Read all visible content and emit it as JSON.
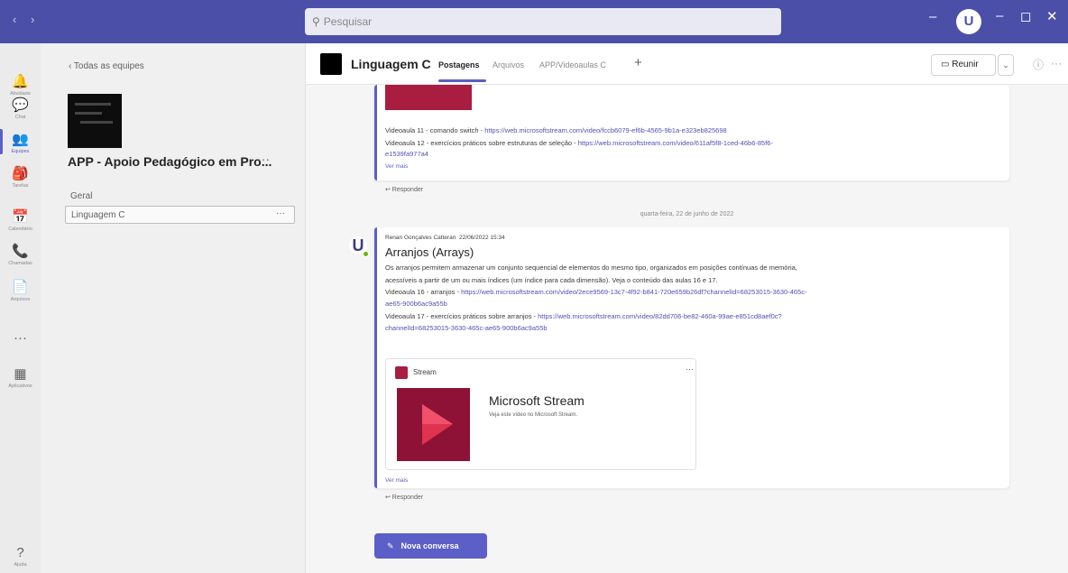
{
  "titlebar": {
    "nav": "‹ ›",
    "search_placeholder": "Pesquisar",
    "search_icon": "search-icon",
    "more": "···",
    "avatar_initial": "U",
    "minimize": "–",
    "maximize": "◻",
    "close": "✕",
    "bg_color": "#4b4fa8"
  },
  "rail": {
    "items": [
      {
        "label": "Atividade",
        "icon": "bell-icon",
        "glyph": "🔔"
      },
      {
        "label": "Chat",
        "icon": "chat-icon",
        "glyph": "💬"
      },
      {
        "label": "Equipes",
        "icon": "teams-icon",
        "glyph": "👥"
      },
      {
        "label": "Tarefas",
        "icon": "assignments-icon",
        "glyph": "🎒"
      },
      {
        "label": "Calendário",
        "icon": "calendar-icon",
        "glyph": "📅"
      },
      {
        "label": "Chamadas",
        "icon": "phone-icon",
        "glyph": "📞"
      },
      {
        "label": "Arquivos",
        "icon": "file-icon",
        "glyph": "📄"
      },
      {
        "label": "",
        "icon": "more-icon",
        "glyph": "···"
      },
      {
        "label": "Aplicativos",
        "icon": "apps-icon",
        "glyph": "▦"
      },
      {
        "label": "Ajuda",
        "icon": "help-icon",
        "glyph": "?"
      }
    ],
    "active_index": 2
  },
  "team_panel": {
    "back_label": "‹  Todas as equipes",
    "team_name": "APP - Apoio Pedagógico em Pro...",
    "team_more": "···",
    "channels": [
      {
        "label": "Geral",
        "selected": false
      },
      {
        "label": "Linguagem C",
        "selected": true
      }
    ],
    "channel_more": "···"
  },
  "channel_header": {
    "name": "Linguagem C",
    "tabs": [
      {
        "label": "Postagens",
        "active": true
      },
      {
        "label": "Arquivos",
        "active": false
      },
      {
        "label": "APP/Videoaulas C",
        "active": false
      }
    ],
    "add_tab": "+",
    "meet_label": "Reunir",
    "meet_icon": "video-icon",
    "meet_drop": "⌄",
    "info_icon": "info-icon",
    "more": "···"
  },
  "post1": {
    "line1_text": "Videoaula 11 - comando switch - ",
    "line1_link": "https://web.microsoftstream.com/video/fccb6079-ef6b-4565-9b1a-e323eb825698",
    "line2_text": "Videoaula 12 - exercícios práticos sobre estruturas de seleção - ",
    "line2_link": "https://web.microsoftstream.com/video/611af5f8-1ced-46b6-85f6-",
    "line3_link": "e1539fa977a4",
    "see_more": "Ver mais",
    "reply": "↩ Responder"
  },
  "date_separator": "quarta-feira, 22 de junho de 2022",
  "post2": {
    "author": "Renan Gonçalves Catteran",
    "time": "22/06/2022 15:34",
    "title": "Arranjos (Arrays)",
    "body1": "Os arranjos permitem armazenar um conjunto sequencial de elementos do mesmo tipo, organizados em posições contínuas de memória,",
    "body2": "acessíveis a partir de um ou mais índices (um índice para cada dimensão). Veja o conteúdo das aulas 16 e 17.",
    "line16_text": "Videoaula 16 - arranjos - ",
    "line16_link": "https://web.microsoftstream.com/video/2ece9569-13c7-4f92-b841-720e659b26df?channelId=68253015-3630-465c-",
    "line16_link2": "ae65-900b6ac9a55b",
    "line17_text": "Videoaula 17 - exercícios práticos sobre arranjos - ",
    "line17_link": "https://web.microsoftstream.com/video/82dd706-be82-460a-99ae-e851cd8aef0c?",
    "line17_link2": "channelId=68253015-3630-465c-ae65-900b6ac9a55b",
    "card": {
      "source": "Stream",
      "more": "···",
      "title": "Microsoft Stream",
      "description": "Veja este vídeo no Microsoft Stream.",
      "icon": "stream-icon"
    },
    "see_more": "Ver mais",
    "reply": "↩ Responder",
    "avatar_initial": "U"
  },
  "new_conversation": {
    "label": "Nova conversa",
    "icon": "compose-icon"
  },
  "colors": {
    "accent": "#5b5fc7",
    "stream": "#a81d40"
  }
}
